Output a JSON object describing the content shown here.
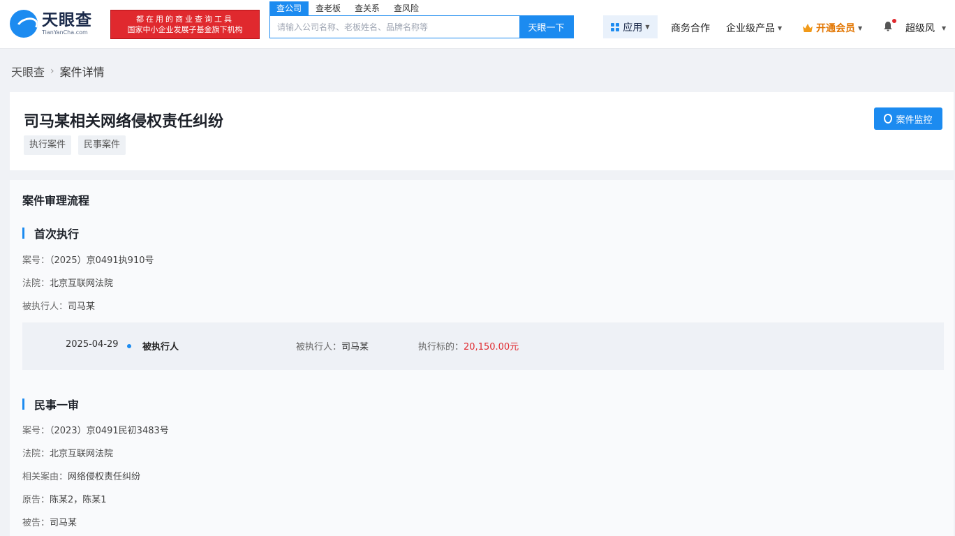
{
  "header": {
    "logo_name": "天眼查",
    "logo_domain": "TianYanCha.com",
    "promo_line1": "都在用的商业查询工具",
    "promo_line2": "国家中小企业发展子基金旗下机构",
    "search_tabs": [
      "查公司",
      "查老板",
      "查关系",
      "查风险"
    ],
    "search_placeholder": "请输入公司名称、老板姓名、品牌名称等",
    "search_button": "天眼一下",
    "apps_label": "应用",
    "business_label": "商务合作",
    "enterprise_label": "企业级产品",
    "vip_label": "开通会员",
    "username": "超级风"
  },
  "breadcrumb": {
    "home": "天眼查",
    "current": "案件详情"
  },
  "case": {
    "title": "司马某相关网络侵权责任纠纷",
    "tags": [
      "执行案件",
      "民事案件"
    ],
    "monitor_button": "案件监控"
  },
  "process": {
    "section_title": "案件审理流程",
    "stage1": {
      "title": "首次执行",
      "case_no_label": "案号：",
      "case_no": "（2025）京0491执910号",
      "court_label": "法院：",
      "court": "北京互联网法院",
      "defendant_label": "被执行人：",
      "defendant": "司马某",
      "record": {
        "date": "2025-04-29",
        "role": "被执行人",
        "person_label": "被执行人：",
        "person": "司马某",
        "amount_label": "执行标的：",
        "amount": "20,150.00元"
      }
    },
    "stage2": {
      "title": "民事一审",
      "case_no_label": "案号：",
      "case_no": "（2023）京0491民初3483号",
      "court_label": "法院：",
      "court": "北京互联网法院",
      "cause_label": "相关案由：",
      "cause": "网络侵权责任纠纷",
      "plaintiff_label": "原告：",
      "plaintiff": "陈某2，陈某1",
      "defendant_label": "被告：",
      "defendant": "司马某"
    }
  }
}
